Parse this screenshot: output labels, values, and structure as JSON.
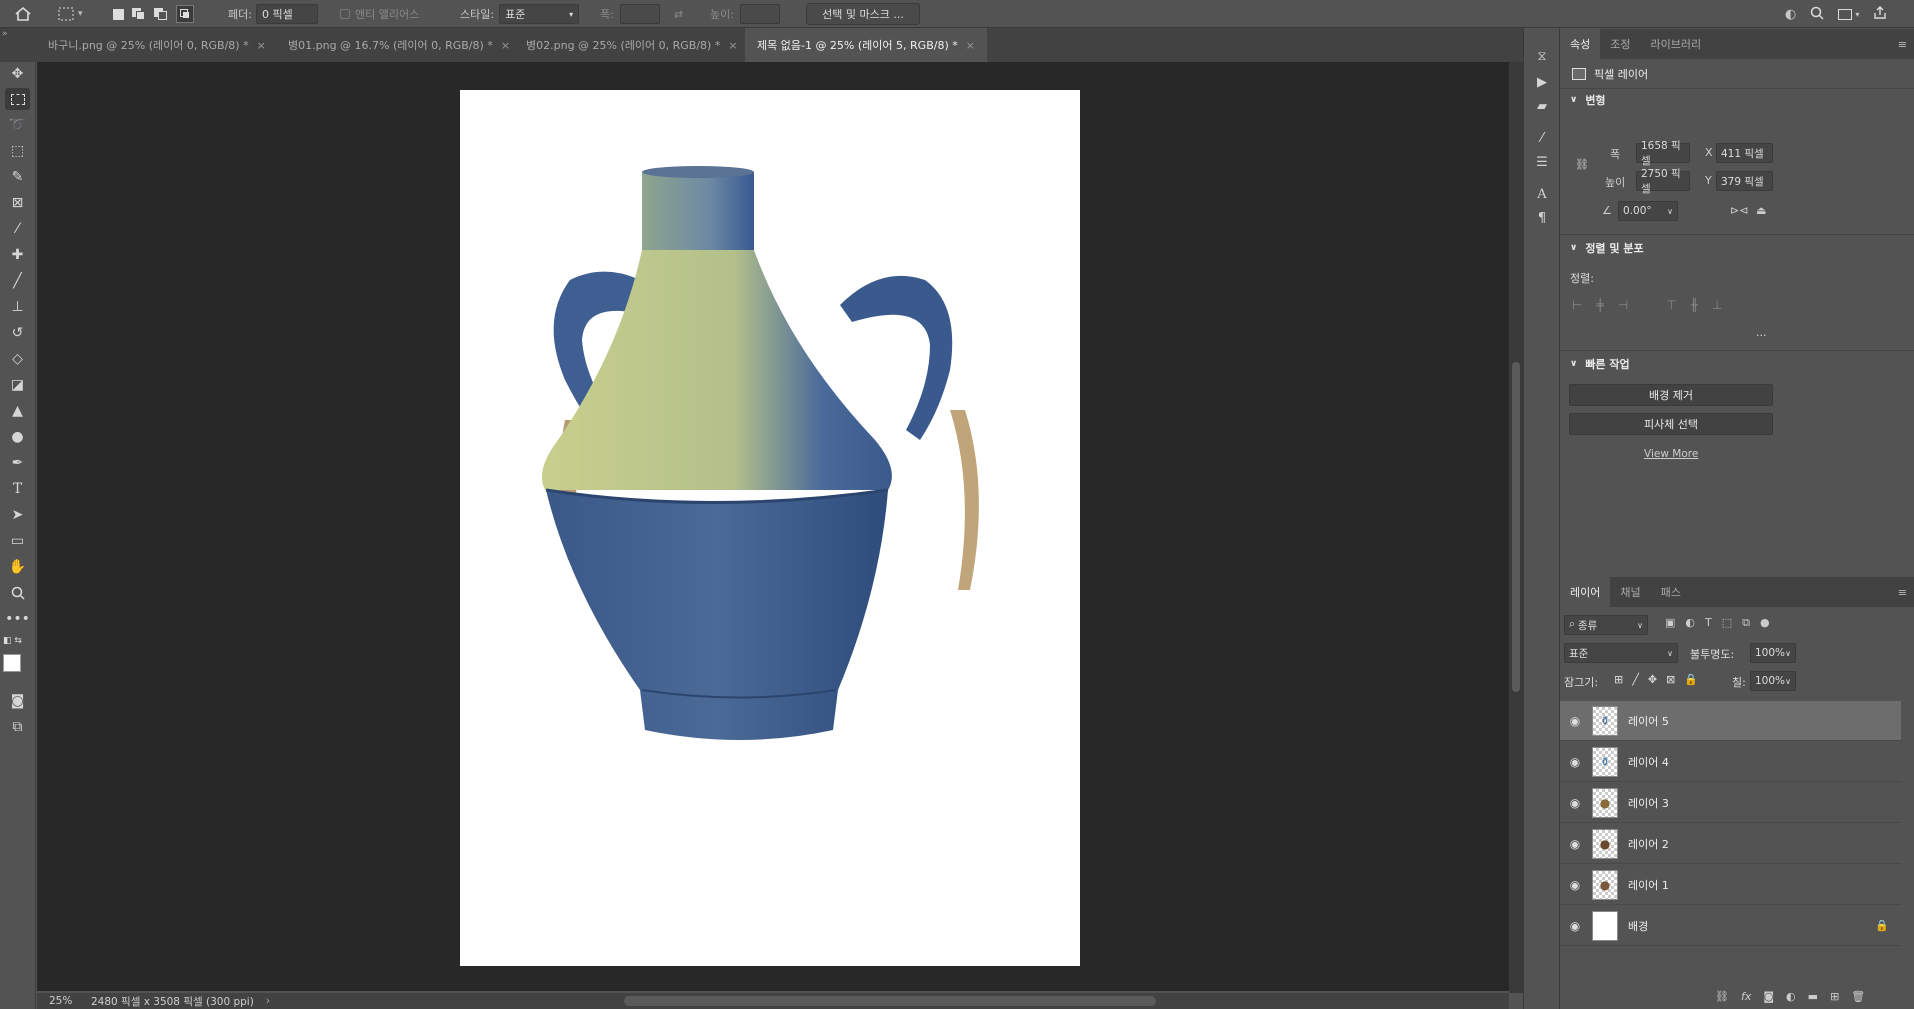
{
  "options_bar": {
    "feather_label": "페더:",
    "feather_value": "0 픽셀",
    "antialias_label": "앤티 앨리어스",
    "style_label": "스타일:",
    "style_value": "표준",
    "width_label": "폭:",
    "height_label": "높이:",
    "select_mask_label": "선택 및 마스크 ..."
  },
  "tabs": [
    {
      "label": "바구니.png @ 25% (레이어 0, RGB/8) *",
      "active": false
    },
    {
      "label": "병01.png @ 16.7% (레이어 0, RGB/8) *",
      "active": false
    },
    {
      "label": "병02.png @ 25% (레이어 0, RGB/8) *",
      "active": false
    },
    {
      "label": "제목 없음-1 @ 25% (레이어 5, RGB/8) *",
      "active": true
    }
  ],
  "tab_close_glyph": "×",
  "status": {
    "zoom": "25%",
    "doc_info": "2480 픽셀 x 3508 픽셀 (300 ppi)",
    "arrow": "›"
  },
  "properties_panel": {
    "tabs": [
      "속성",
      "조정",
      "라이브러리"
    ],
    "layer_type": "픽셀 레이어",
    "transform": {
      "title": "변형",
      "w_label": "폭",
      "w_value": "1658 픽셀",
      "x_label": "X",
      "x_value": "411 픽셀",
      "h_label": "높이",
      "h_value": "2750 픽셀",
      "y_label": "Y",
      "y_value": "379 픽셀",
      "angle_value": "0.00°"
    },
    "align": {
      "title": "정렬 및 분포",
      "align_label": "정렬:",
      "more": "..."
    },
    "quick_actions": {
      "title": "빠른 작업",
      "remove_bg": "배경 제거",
      "select_subject": "피사체 선택",
      "view_more": "View More"
    }
  },
  "layers_panel": {
    "tabs": [
      "레이어",
      "채널",
      "패스"
    ],
    "filter_value": "종류",
    "blend_mode": "표준",
    "opacity_label": "불투명도:",
    "opacity_value": "100%",
    "lock_label": "잠그기:",
    "fill_label": "칠:",
    "fill_value": "100%",
    "layers": [
      {
        "name": "레이어 5",
        "selected": true
      },
      {
        "name": "레이어 4",
        "selected": false
      },
      {
        "name": "레이어 3",
        "selected": false
      },
      {
        "name": "레이어 2",
        "selected": false
      },
      {
        "name": "레이어 1",
        "selected": false
      },
      {
        "name": "배경",
        "selected": false,
        "locked": true
      }
    ]
  },
  "colors": {
    "accent": "#535353",
    "canvas_bg": "#282828",
    "selected_layer": "#6d6d6d",
    "jug_top": "#c9cf8c",
    "jug_body": "#3d5f8f"
  }
}
